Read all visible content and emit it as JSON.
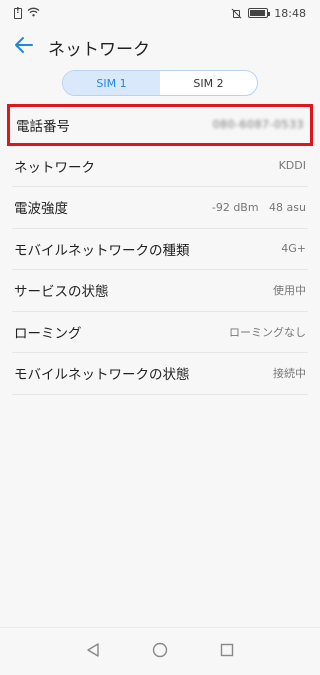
{
  "status_bar": {
    "time": "18:48"
  },
  "header": {
    "title": "ネットワーク"
  },
  "tabs": [
    {
      "label": "SIM 1",
      "active": true
    },
    {
      "label": "SIM 2",
      "active": false
    }
  ],
  "rows": [
    {
      "label": "電話番号",
      "value": "080-6087-0533"
    },
    {
      "label": "ネットワーク",
      "value": "KDDI"
    },
    {
      "label": "電波強度",
      "value": "-92 dBm   48 asu"
    },
    {
      "label": "モバイルネットワークの種類",
      "value": "4G+"
    },
    {
      "label": "サービスの状態",
      "value": "使用中"
    },
    {
      "label": "ローミング",
      "value": "ローミングなし"
    },
    {
      "label": "モバイルネットワークの状態",
      "value": "接続中"
    }
  ],
  "colors": {
    "accent": "#1e88e5",
    "highlight": "#e0161d"
  }
}
